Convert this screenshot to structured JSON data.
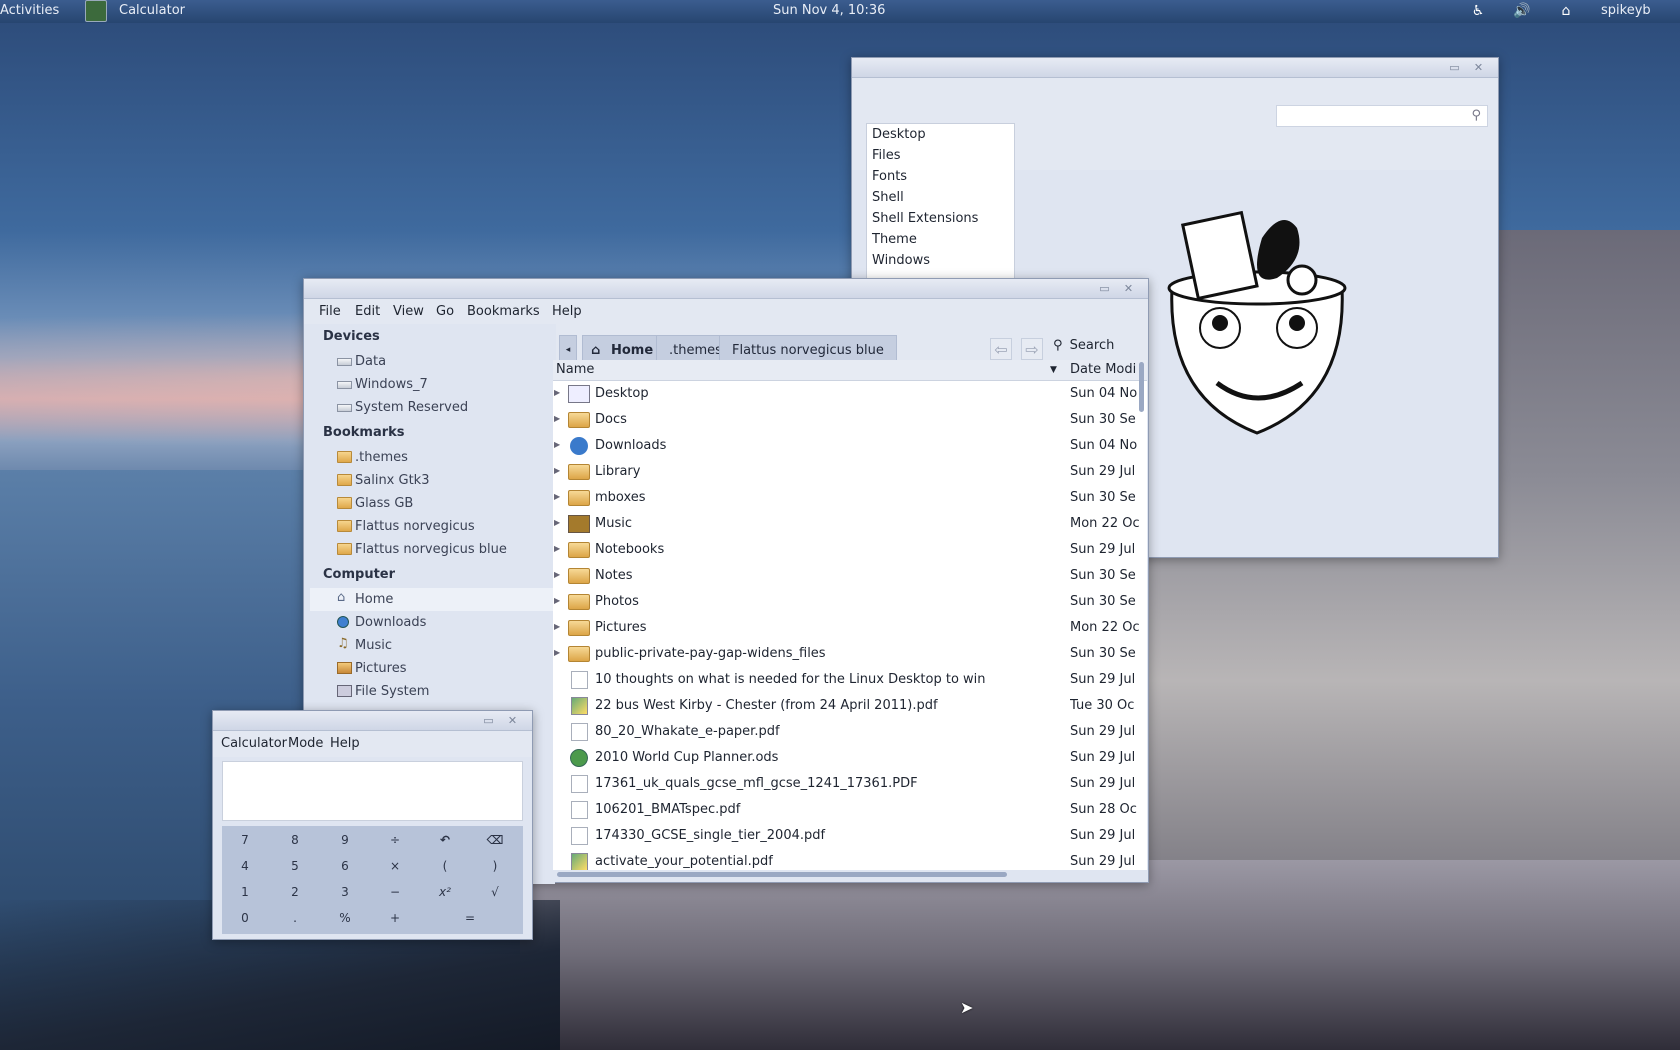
{
  "topbar": {
    "activities": "Activities",
    "app_name": "Calculator",
    "clock": "Sun Nov  4, 10:36",
    "user": "spikeyb"
  },
  "tweak": {
    "search_placeholder": "",
    "categories": [
      "Desktop",
      "Files",
      "Fonts",
      "Shell",
      "Shell Extensions",
      "Theme",
      "Windows"
    ]
  },
  "files": {
    "menu": [
      "File",
      "Edit",
      "View",
      "Go",
      "Bookmarks",
      "Help"
    ],
    "sidebar": {
      "devices_heading": "Devices",
      "devices": [
        "Data",
        "Windows_7",
        "System Reserved"
      ],
      "bookmarks_heading": "Bookmarks",
      "bookmarks": [
        ".themes",
        "Salinx Gtk3",
        "Glass GB",
        "Flattus norvegicus",
        "Flattus norvegicus blue"
      ],
      "computer_heading": "Computer",
      "computer": [
        "Home",
        "Downloads",
        "Music",
        "Pictures",
        "File System"
      ]
    },
    "path": [
      "Home",
      ".themes",
      "Flattus norvegicus blue"
    ],
    "search_label": "Search",
    "columns": {
      "name": "Name",
      "date": "Date Modi"
    },
    "rows": [
      {
        "name": "Desktop",
        "date": "Sun 04 No",
        "icon": "desktop-folder-icon"
      },
      {
        "name": "Docs",
        "date": "Sun 30 Se",
        "icon": "folder-icon"
      },
      {
        "name": "Downloads",
        "date": "Sun 04 No",
        "icon": "downloads-folder-icon"
      },
      {
        "name": "Library",
        "date": "Sun 29 Jul",
        "icon": "folder-icon"
      },
      {
        "name": "mboxes",
        "date": "Sun 30 Se",
        "icon": "folder-icon"
      },
      {
        "name": "Music",
        "date": "Mon 22 Oc",
        "icon": "music-folder-icon"
      },
      {
        "name": "Notebooks",
        "date": "Sun 29 Jul",
        "icon": "folder-icon"
      },
      {
        "name": "Notes",
        "date": "Sun 30 Se",
        "icon": "folder-icon"
      },
      {
        "name": "Photos",
        "date": "Sun 30 Se",
        "icon": "folder-icon"
      },
      {
        "name": "Pictures",
        "date": "Mon 22 Oc",
        "icon": "pictures-folder-icon"
      },
      {
        "name": "public-private-pay-gap-widens_files",
        "date": "Sun 30 Se",
        "icon": "folder-icon"
      },
      {
        "name": "10 thoughts on what is needed for the Linux Desktop to win",
        "date": "Sun 29 Jul",
        "icon": "document-icon"
      },
      {
        "name": "22 bus West Kirby - Chester (from 24 April 2011).pdf",
        "date": "Tue 30 Oc",
        "icon": "pdf-thumbnail-icon"
      },
      {
        "name": "80_20_Whakate_e-paper.pdf",
        "date": "Sun 29 Jul",
        "icon": "document-icon"
      },
      {
        "name": "2010 World Cup Planner.ods",
        "date": "Sun 29 Jul",
        "icon": "spreadsheet-icon"
      },
      {
        "name": "17361_uk_quals_gcse_mfl_gcse_1241_17361.PDF",
        "date": "Sun 29 Jul",
        "icon": "document-icon"
      },
      {
        "name": "106201_BMATspec.pdf",
        "date": "Sun 28 Oc",
        "icon": "document-icon"
      },
      {
        "name": "174330_GCSE_single_tier_2004.pdf",
        "date": "Sun 29 Jul",
        "icon": "document-icon"
      },
      {
        "name": "activate_your_potential.pdf",
        "date": "Sun 29 Jul",
        "icon": "pdf-thumbnail-icon"
      }
    ]
  },
  "calculator": {
    "menu": [
      "Calculator",
      "Mode",
      "Help"
    ],
    "display": "",
    "keys": [
      [
        "7",
        "8",
        "9",
        "÷",
        "↶",
        "⌫"
      ],
      [
        "4",
        "5",
        "6",
        "×",
        "(",
        ")"
      ],
      [
        "1",
        "2",
        "3",
        "−",
        "x²",
        "√"
      ],
      [
        "0",
        ".",
        "%",
        "+",
        "="
      ]
    ]
  }
}
